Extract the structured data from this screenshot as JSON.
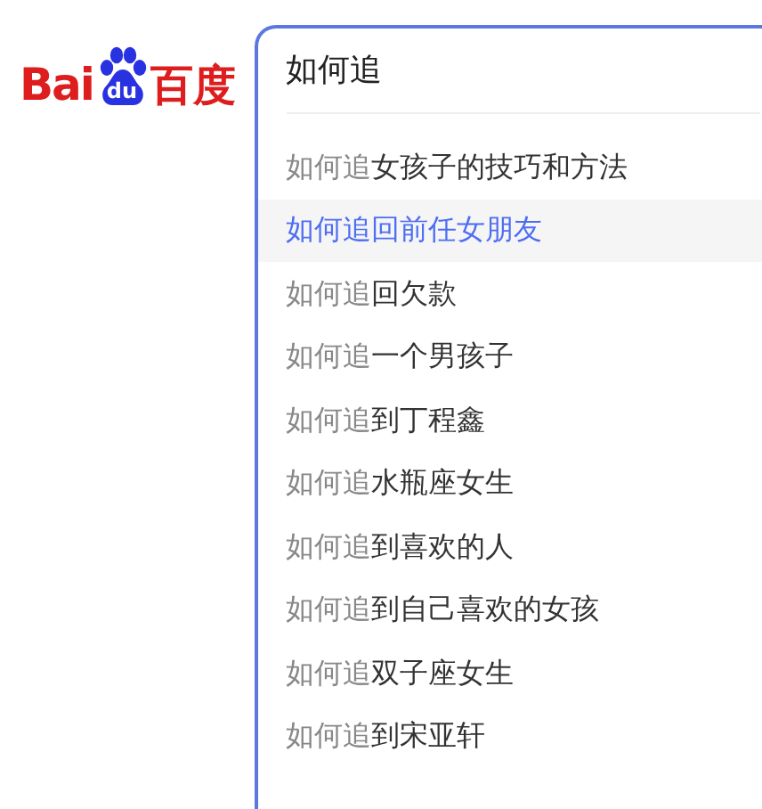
{
  "logo": {
    "left": "Bai",
    "paw": "du",
    "right": "百度"
  },
  "search": {
    "value": "如何追"
  },
  "suggestions": [
    {
      "prefix": "如何追",
      "rest": "女孩子的技巧和方法",
      "selected": false
    },
    {
      "prefix": "如何追",
      "rest": "回前任女朋友",
      "selected": true
    },
    {
      "prefix": "如何追",
      "rest": "回欠款",
      "selected": false
    },
    {
      "prefix": "如何追",
      "rest": "一个男孩子",
      "selected": false
    },
    {
      "prefix": "如何追",
      "rest": "到丁程鑫",
      "selected": false
    },
    {
      "prefix": "如何追",
      "rest": "水瓶座女生",
      "selected": false
    },
    {
      "prefix": "如何追",
      "rest": "到喜欢的人",
      "selected": false
    },
    {
      "prefix": "如何追",
      "rest": "到自己喜欢的女孩",
      "selected": false
    },
    {
      "prefix": "如何追",
      "rest": "双子座女生",
      "selected": false
    },
    {
      "prefix": "如何追",
      "rest": "到宋亚轩",
      "selected": false
    }
  ]
}
